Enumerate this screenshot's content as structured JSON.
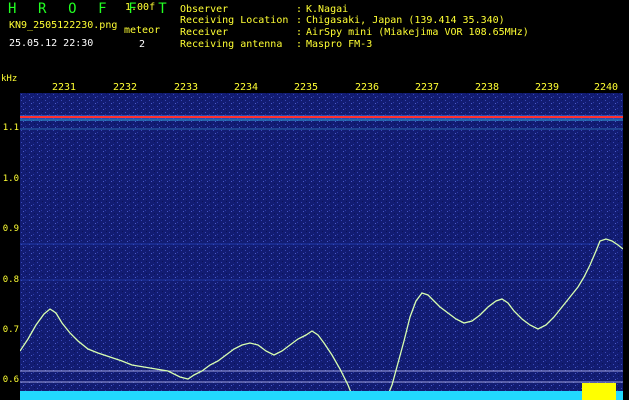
{
  "header": {
    "app_name": "H R O F F T",
    "version": "1.00f",
    "filename": "KN9_2505122230.png",
    "mode": "meteor",
    "datetime": "25.05.12 22:30",
    "count": "2",
    "info": [
      {
        "label": "Observer",
        "value": "K.Nagai"
      },
      {
        "label": "Receiving Location",
        "value": "Chigasaki, Japan (139.414 35.340)"
      },
      {
        "label": "Receiver",
        "value": "AirSpy mini (Miakejima VOR 108.65MHz)"
      },
      {
        "label": "Receiving antenna",
        "value": "Maspro FM-3"
      }
    ]
  },
  "axis": {
    "unit": "kHz",
    "time_ticks": [
      "2231",
      "2232",
      "2233",
      "2234",
      "2235",
      "2236",
      "2237",
      "2238",
      "2239",
      "2240"
    ],
    "freq_ticks": [
      "1.1",
      "1.0",
      "0.9",
      "0.8",
      "0.7",
      "0.6"
    ]
  },
  "colors": {
    "text_green": "#22ff22",
    "text_yellow": "#ffff33",
    "background": "#000000",
    "spectrum_bg": "#101a6e",
    "carrier": "#ff3030",
    "trace": "#d8ffb0",
    "floor": "#22d8ff",
    "marker": "#ffff00"
  }
}
